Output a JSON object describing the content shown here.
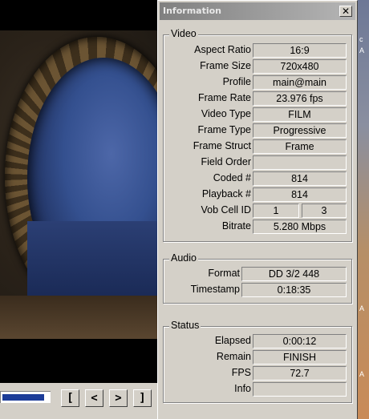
{
  "window": {
    "title": "Information",
    "close_glyph": "✕"
  },
  "player": {
    "controls": [
      "[",
      "<",
      ">",
      "]"
    ],
    "seek_fraction": 0.9
  },
  "desktop": {
    "fragment_1": "c",
    "fragment_2": "A",
    "fragment_3": "A",
    "fragment_4": "A"
  },
  "video": {
    "label": "Video",
    "rows": [
      {
        "label": "Aspect Ratio",
        "value": "16:9"
      },
      {
        "label": "Frame Size",
        "value": "720x480"
      },
      {
        "label": "Profile",
        "value": "main@main"
      },
      {
        "label": "Frame Rate",
        "value": "23.976 fps"
      },
      {
        "label": "Video Type",
        "value": "FILM"
      },
      {
        "label": "Frame Type",
        "value": "Progressive"
      },
      {
        "label": "Frame Struct",
        "value": "Frame"
      },
      {
        "label": "Field Order",
        "value": ""
      },
      {
        "label": "Coded #",
        "value": "814"
      },
      {
        "label": "Playback #",
        "value": "814"
      }
    ],
    "vob_cell": {
      "label": "Vob Cell ID",
      "value1": "1",
      "value2": "3"
    },
    "bitrate": {
      "label": "Bitrate",
      "value": "5.280 Mbps"
    }
  },
  "audio": {
    "label": "Audio",
    "rows": [
      {
        "label": "Format",
        "value": "DD 3/2 448"
      },
      {
        "label": "Timestamp",
        "value": "0:18:35"
      }
    ]
  },
  "status": {
    "label": "Status",
    "rows": [
      {
        "label": "Elapsed",
        "value": "0:00:12"
      },
      {
        "label": "Remain",
        "value": "FINISH"
      },
      {
        "label": "FPS",
        "value": "72.7"
      },
      {
        "label": "Info",
        "value": ""
      }
    ]
  }
}
